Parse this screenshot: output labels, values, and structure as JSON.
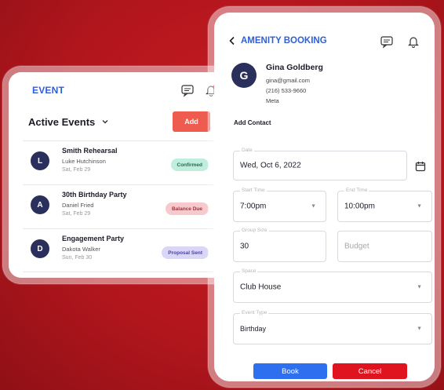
{
  "event_card": {
    "title": "EVENT",
    "filter_label": "Active Events",
    "add_label": "Add",
    "items": [
      {
        "initial": "L",
        "name": "Smith Rehearsal",
        "person": "Luke Hutchinson",
        "date": "Sat, Feb 29",
        "status": "Confirmed",
        "status_bg": "#bfeedd",
        "status_fg": "#1f6f52"
      },
      {
        "initial": "A",
        "name": "30th Birthday Party",
        "person": "Daniel Fried",
        "date": "Sat, Feb 29",
        "status": "Balance Due",
        "status_bg": "#f7c9cc",
        "status_fg": "#a4323b"
      },
      {
        "initial": "D",
        "name": "Engagement Party",
        "person": "Dakota Walker",
        "date": "Sun, Feb 30",
        "status": "Proposal Sent",
        "status_bg": "#d9d6f7",
        "status_fg": "#4a44a8"
      }
    ]
  },
  "booking": {
    "title": "AMENITY BOOKING",
    "contact": {
      "initial": "G",
      "name": "Gina Goldberg",
      "email": "gina@gmail.com",
      "phone": "(216) 533-9660",
      "org": "Meta"
    },
    "add_contact": "Add Contact",
    "fields": {
      "date": {
        "label": "Date",
        "value": "Wed, Oct 6, 2022"
      },
      "start_time": {
        "label": "Start Time",
        "value": "7:00pm"
      },
      "end_time": {
        "label": "End Time",
        "value": "10:00pm"
      },
      "group_size": {
        "label": "Group Size",
        "value": "30"
      },
      "budget": {
        "placeholder": "Budget"
      },
      "space": {
        "label": "Space",
        "value": "Club House"
      },
      "event_type": {
        "label": "Event Type",
        "value": "Birthday"
      }
    },
    "book_label": "Book",
    "cancel_label": "Cancel"
  },
  "colors": {
    "accent_blue": "#2f5fd6",
    "add_button": "#ee5b4f",
    "book_button": "#2e6ff0",
    "cancel_button": "#e0141f",
    "background": "#b3161d"
  }
}
